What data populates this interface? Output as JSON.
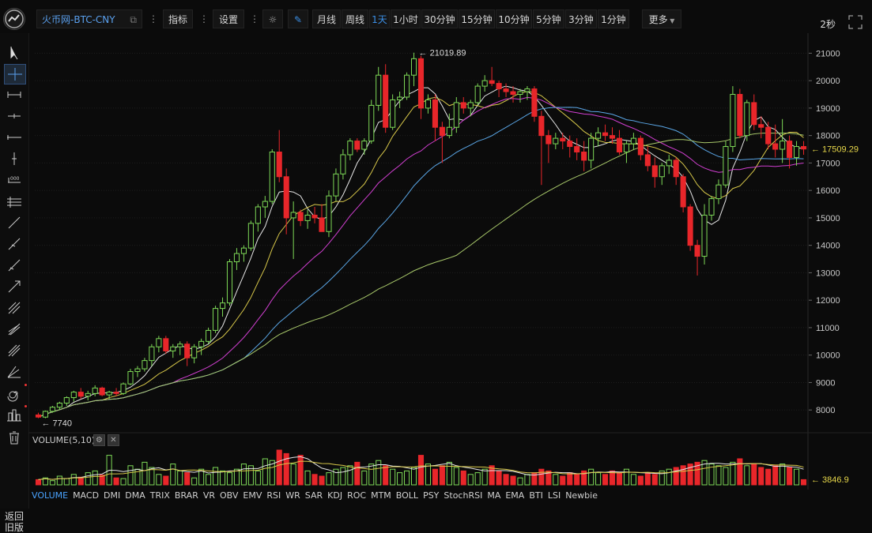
{
  "toolbar": {
    "pair": "火币网-BTC-CNY",
    "indicators": "指标",
    "settings": "设置",
    "periods": [
      "月线",
      "周线",
      "1天",
      "1小时",
      "30分钟",
      "15分钟",
      "10分钟",
      "5分钟",
      "3分钟",
      "1分钟"
    ],
    "active_period": "1天",
    "more": "更多",
    "refresh_interval": "2秒"
  },
  "sidebar": {
    "back_label": "返回旧版"
  },
  "volume_panel": {
    "title": "VOLUME(5,10)",
    "current_volume": "3846.9"
  },
  "indicator_tabs": [
    "VOLUME",
    "MACD",
    "DMI",
    "DMA",
    "TRIX",
    "BRAR",
    "VR",
    "OBV",
    "EMV",
    "RSI",
    "WR",
    "SAR",
    "KDJ",
    "ROC",
    "MTM",
    "BOLL",
    "PSY",
    "StochRSI",
    "MA",
    "EMA",
    "BTI",
    "LSI",
    "Newbie"
  ],
  "active_indicator": "VOLUME",
  "chart_data": {
    "type": "candlestick",
    "y_ticks": [
      8000,
      9000,
      10000,
      11000,
      12000,
      13000,
      14000,
      15000,
      16000,
      17000,
      18000,
      19000,
      20000,
      21000
    ],
    "ylim": [
      7200,
      21500
    ],
    "annotations": {
      "high": "21019.89",
      "low": "7740",
      "last": "17509.29"
    },
    "colors": {
      "up": "#7ed957",
      "down": "#e8262a",
      "bg": "#0b0b0b",
      "grid": "#1e1e1e",
      "ma_white": "#e6e6e6",
      "ma_yellow": "#d9c94a",
      "ma_magenta": "#d13fd1",
      "ma_blue": "#5aa6e6",
      "ma_green": "#a8c86a",
      "accent": "#3b8fe6"
    },
    "candles": [
      [
        7820,
        7900,
        7700,
        7740
      ],
      [
        7740,
        7980,
        7700,
        7950
      ],
      [
        7950,
        8150,
        7900,
        8100
      ],
      [
        8100,
        8300,
        8000,
        8250
      ],
      [
        8250,
        8500,
        8150,
        8450
      ],
      [
        8450,
        8700,
        8300,
        8650
      ],
      [
        8650,
        8800,
        8400,
        8500
      ],
      [
        8500,
        8700,
        8350,
        8600
      ],
      [
        8600,
        8900,
        8500,
        8800
      ],
      [
        8800,
        8850,
        8500,
        8550
      ],
      [
        8550,
        8700,
        8400,
        8650
      ],
      [
        8650,
        8800,
        8500,
        8600
      ],
      [
        8600,
        9000,
        8550,
        8950
      ],
      [
        8950,
        9500,
        8900,
        9400
      ],
      [
        9400,
        9600,
        9200,
        9500
      ],
      [
        9500,
        9900,
        9400,
        9800
      ],
      [
        9800,
        10400,
        9600,
        10300
      ],
      [
        10300,
        10700,
        10100,
        10600
      ],
      [
        10600,
        10700,
        10050,
        10150
      ],
      [
        10150,
        10400,
        9900,
        10300
      ],
      [
        10300,
        10500,
        10000,
        10400
      ],
      [
        10400,
        10500,
        9600,
        9900
      ],
      [
        9900,
        10400,
        9700,
        10300
      ],
      [
        10300,
        10600,
        10000,
        10500
      ],
      [
        10500,
        11000,
        10400,
        10900
      ],
      [
        10900,
        11800,
        10800,
        11700
      ],
      [
        11700,
        12100,
        11400,
        11900
      ],
      [
        11900,
        13500,
        11800,
        13400
      ],
      [
        13400,
        13900,
        13100,
        13700
      ],
      [
        13700,
        14000,
        13400,
        13900
      ],
      [
        13900,
        14900,
        13800,
        14800
      ],
      [
        14800,
        15500,
        14500,
        15400
      ],
      [
        15400,
        15800,
        15000,
        15600
      ],
      [
        15600,
        17500,
        15500,
        17400
      ],
      [
        17400,
        18200,
        16300,
        16500
      ],
      [
        16500,
        16800,
        14400,
        15000
      ],
      [
        15000,
        15600,
        13500,
        15200
      ],
      [
        15200,
        15300,
        14700,
        14900
      ],
      [
        14900,
        15300,
        14600,
        15100
      ],
      [
        15100,
        15400,
        14800,
        15000
      ],
      [
        15000,
        15500,
        14700,
        14500
      ],
      [
        14500,
        16000,
        14300,
        15800
      ],
      [
        15800,
        16800,
        15600,
        16600
      ],
      [
        16600,
        17500,
        16400,
        17300
      ],
      [
        17300,
        17900,
        17100,
        17800
      ],
      [
        17800,
        17900,
        17400,
        17500
      ],
      [
        17500,
        17900,
        17300,
        17800
      ],
      [
        17800,
        19300,
        17700,
        19100
      ],
      [
        19100,
        20500,
        18900,
        20200
      ],
      [
        20200,
        20600,
        18100,
        18300
      ],
      [
        18300,
        19500,
        18200,
        19300
      ],
      [
        19300,
        19600,
        19000,
        19400
      ],
      [
        19400,
        20300,
        19300,
        20200
      ],
      [
        20200,
        21019,
        19800,
        20800
      ],
      [
        20800,
        20900,
        18600,
        19000
      ],
      [
        19000,
        19500,
        18800,
        19300
      ],
      [
        19300,
        19500,
        17800,
        18300
      ],
      [
        18300,
        18500,
        17000,
        18000
      ],
      [
        18000,
        18800,
        17900,
        18300
      ],
      [
        18300,
        19400,
        18100,
        19200
      ],
      [
        19200,
        19400,
        18800,
        19000
      ],
      [
        19000,
        19300,
        18700,
        19200
      ],
      [
        19200,
        19900,
        19100,
        19800
      ],
      [
        19800,
        20200,
        19600,
        20000
      ],
      [
        20000,
        20500,
        19800,
        19900
      ],
      [
        19900,
        20000,
        19400,
        19700
      ],
      [
        19700,
        19900,
        19400,
        19600
      ],
      [
        19600,
        19800,
        19200,
        19500
      ],
      [
        19500,
        19700,
        19200,
        19600
      ],
      [
        19600,
        19800,
        19300,
        19700
      ],
      [
        19700,
        19800,
        18500,
        18700
      ],
      [
        18700,
        18900,
        16200,
        18000
      ],
      [
        18000,
        18200,
        17000,
        17700
      ],
      [
        17700,
        18100,
        17500,
        17900
      ],
      [
        17900,
        18100,
        17500,
        17800
      ],
      [
        17800,
        18000,
        17200,
        17600
      ],
      [
        17600,
        17900,
        17100,
        17400
      ],
      [
        17400,
        17800,
        16700,
        17100
      ],
      [
        17100,
        18100,
        16800,
        17900
      ],
      [
        17900,
        18300,
        17600,
        18100
      ],
      [
        18100,
        18400,
        17800,
        18000
      ],
      [
        18000,
        18300,
        17700,
        17900
      ],
      [
        17900,
        18200,
        17300,
        17400
      ],
      [
        17400,
        17800,
        17000,
        17700
      ],
      [
        17700,
        18100,
        17500,
        17900
      ],
      [
        17900,
        18000,
        17100,
        17300
      ],
      [
        17300,
        17600,
        16700,
        16900
      ],
      [
        16900,
        17200,
        16100,
        16500
      ],
      [
        16500,
        17000,
        16200,
        16900
      ],
      [
        16900,
        17300,
        16600,
        17100
      ],
      [
        17100,
        17200,
        16200,
        16500
      ],
      [
        16500,
        16600,
        15200,
        15400
      ],
      [
        15400,
        15500,
        13800,
        14000
      ],
      [
        14000,
        14200,
        12900,
        13600
      ],
      [
        13600,
        15500,
        13300,
        15100
      ],
      [
        15100,
        15800,
        14900,
        15700
      ],
      [
        15700,
        16400,
        15500,
        16200
      ],
      [
        16200,
        17800,
        16100,
        17600
      ],
      [
        17600,
        19800,
        17400,
        19500
      ],
      [
        19500,
        19700,
        17900,
        18000
      ],
      [
        18000,
        19300,
        17800,
        19200
      ],
      [
        19200,
        19500,
        18200,
        18400
      ],
      [
        18400,
        18700,
        17900,
        18300
      ],
      [
        18300,
        18500,
        17500,
        17700
      ],
      [
        17700,
        18400,
        17200,
        17500
      ],
      [
        17500,
        18600,
        17000,
        17800
      ],
      [
        17800,
        18000,
        16800,
        17200
      ],
      [
        17200,
        17800,
        16900,
        17600
      ],
      [
        17600,
        17800,
        17300,
        17509
      ]
    ],
    "volumes": [
      0.15,
      0.2,
      0.12,
      0.25,
      0.18,
      0.3,
      0.22,
      0.35,
      0.4,
      0.28,
      0.85,
      0.2,
      0.18,
      0.55,
      0.45,
      0.65,
      0.5,
      0.3,
      0.25,
      0.6,
      0.4,
      0.35,
      0.2,
      0.45,
      0.3,
      0.5,
      0.4,
      0.35,
      0.45,
      0.6,
      0.55,
      0.4,
      0.75,
      0.7,
      1.0,
      0.9,
      0.6,
      0.85,
      0.4,
      0.3,
      0.25,
      0.35,
      0.45,
      0.5,
      0.55,
      0.65,
      0.4,
      0.6,
      0.7,
      0.55,
      0.45,
      0.35,
      0.4,
      0.5,
      0.85,
      0.6,
      0.45,
      0.55,
      0.65,
      0.5,
      0.4,
      0.3,
      0.35,
      0.45,
      0.55,
      0.4,
      0.3,
      0.25,
      0.2,
      0.3,
      0.35,
      0.45,
      0.4,
      0.3,
      0.25,
      0.35,
      0.3,
      0.4,
      0.45,
      0.35,
      0.3,
      0.4,
      0.35,
      0.45,
      0.3,
      0.25,
      0.35,
      0.3,
      0.4,
      0.45,
      0.5,
      0.55,
      0.6,
      0.65,
      0.7,
      0.6,
      0.55,
      0.5,
      0.65,
      0.75,
      0.55,
      0.6,
      0.5,
      0.45,
      0.55,
      0.6,
      0.5,
      0.45,
      0.15
    ]
  }
}
